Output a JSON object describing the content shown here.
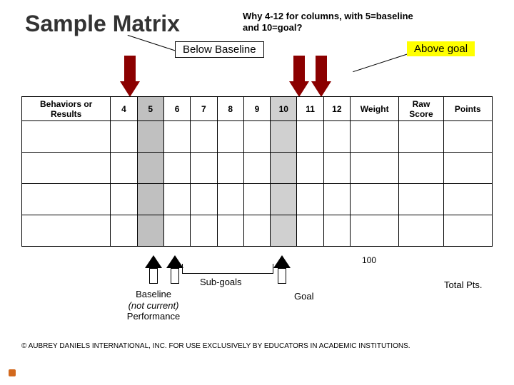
{
  "title": "Sample Matrix",
  "subtitle": "Why 4-12 for columns, with 5=baseline and 10=goal?",
  "labels": {
    "below": "Below Baseline",
    "above": "Above goal",
    "subgoals": "Sub-goals",
    "totalpts": "Total Pts.",
    "goal": "Goal",
    "baseline1": "Baseline",
    "baseline2": "(not current)",
    "baseline3": "Performance",
    "total100": "100"
  },
  "headers": {
    "behaviors": "Behaviors or Results",
    "c4": "4",
    "c5": "5",
    "c6": "6",
    "c7": "7",
    "c8": "8",
    "c9": "9",
    "c10": "10",
    "c11": "11",
    "c12": "12",
    "weight": "Weight",
    "raw": "Raw Score",
    "points": "Points"
  },
  "footer": "© AUBREY DANIELS INTERNATIONAL, INC. FOR USE EXCLUSIVELY BY EDUCATORS IN ACADEMIC INSTITUTIONS."
}
